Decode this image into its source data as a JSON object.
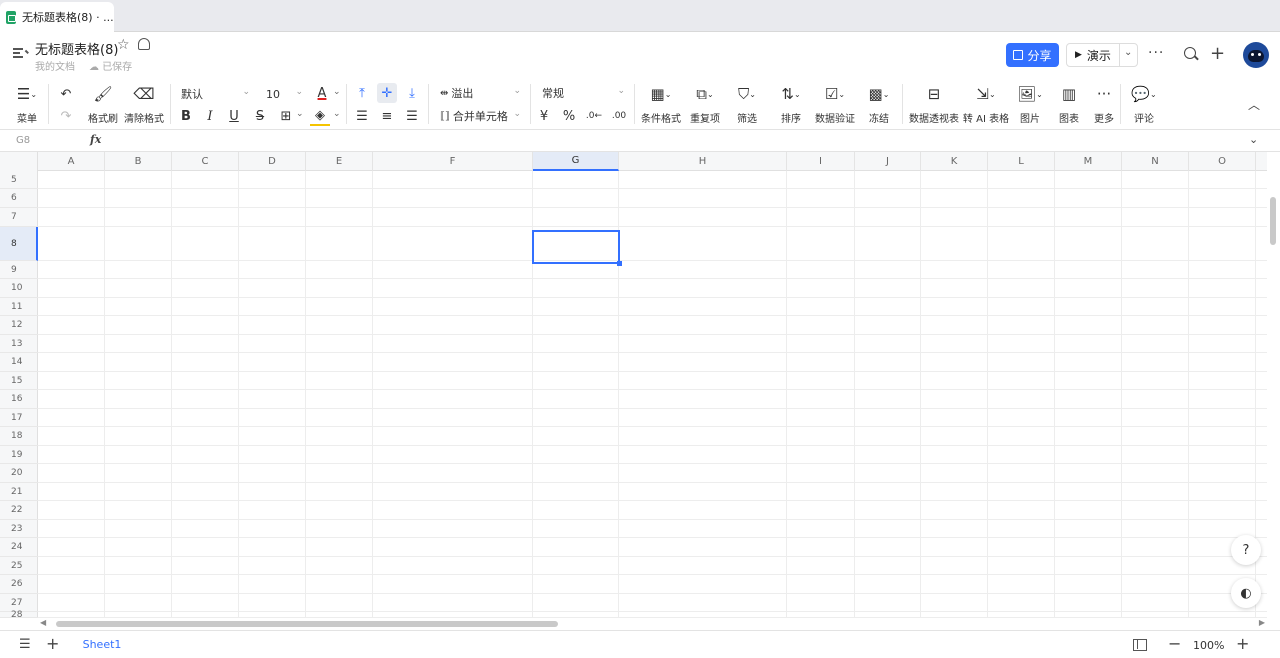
{
  "browser": {
    "tab_title": "无标题表格(8) · ..."
  },
  "header": {
    "doc_title": "无标题表格(8)",
    "location": "我的文档",
    "save_status": "已保存",
    "share_label": "分享",
    "present_label": "演示"
  },
  "toolbar": {
    "menu": "菜单",
    "format_painter": "格式刷",
    "clear_format": "清除格式",
    "font": "默认",
    "font_size": "10",
    "overflow": "溢出",
    "merge_cells": "合并单元格",
    "number_format": "常规",
    "conditional_format": "条件格式",
    "duplicates": "重复项",
    "filter": "筛选",
    "sort": "排序",
    "data_validation": "数据验证",
    "freeze": "冻结",
    "pivot_table": "数据透视表",
    "to_ai_table": "转 AI 表格",
    "image": "图片",
    "chart": "图表",
    "more": "更多",
    "comment": "评论",
    "bold": "B",
    "italic": "I",
    "underline": "U",
    "strike": "S",
    "currency": "¥",
    "percent": "%"
  },
  "formula_bar": {
    "cell_ref": "G8",
    "fx": "fx"
  },
  "grid": {
    "columns": [
      "A",
      "B",
      "C",
      "D",
      "E",
      "F",
      "G",
      "H",
      "I",
      "J",
      "K",
      "L",
      "M",
      "N",
      "O"
    ],
    "rows": [
      "5",
      "6",
      "7",
      "8",
      "9",
      "10",
      "11",
      "12",
      "13",
      "14",
      "15",
      "16",
      "17",
      "18",
      "19",
      "20",
      "21",
      "22",
      "23",
      "24",
      "25",
      "26",
      "27",
      "28"
    ],
    "selected_column": "G",
    "selected_row": "8"
  },
  "bottom": {
    "sheet_name": "Sheet1",
    "zoom": "100%"
  },
  "colors": {
    "accent": "#3370ff"
  }
}
